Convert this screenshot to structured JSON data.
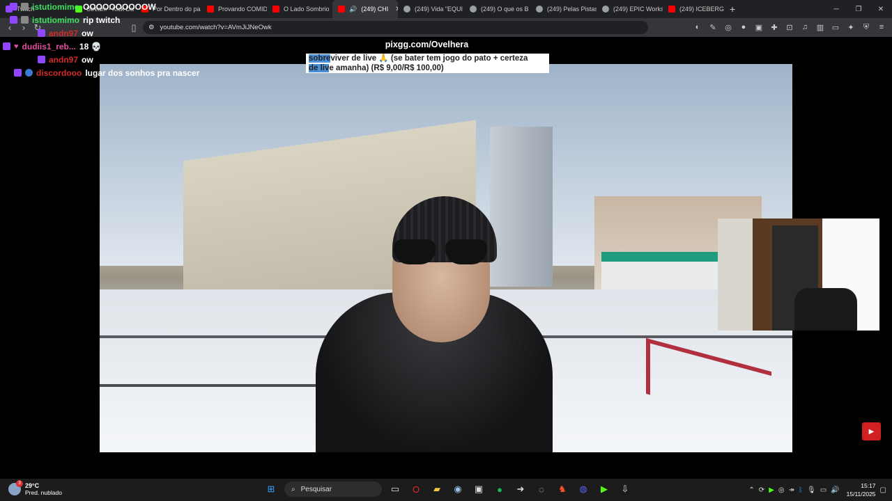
{
  "browser": {
    "tabs": [
      {
        "label": "Twitch",
        "color": "#9146ff"
      },
      {
        "label": "Stream - Kick Da",
        "color": "#53fc18"
      },
      {
        "label": "Por Dentro do pa",
        "color": "#ff0000"
      },
      {
        "label": "Provando COMID",
        "color": "#ff0000"
      },
      {
        "label": "O Lado Sombrio",
        "color": "#ff0000"
      },
      {
        "label": "(249) CHI",
        "color": "#ff0000"
      },
      {
        "label": "(249) Vida \"EQUI",
        "color": "#9aa0a6"
      },
      {
        "label": "(249) O que os B",
        "color": "#9aa0a6"
      },
      {
        "label": "(249) Pelas Pistas",
        "color": "#9aa0a6"
      },
      {
        "label": "(249) EPIC Works",
        "color": "#9aa0a6"
      },
      {
        "label": "(249) ICEBERG D",
        "color": "#ff0000"
      }
    ],
    "new_tab": "+",
    "url": "youtube.com/watch?v=AVmJiJNeOwk"
  },
  "chat": [
    {
      "user": "istutiomimo",
      "color": "#3fe060",
      "message": "OOOOOOOOOOW"
    },
    {
      "user": "istutiomimo",
      "color": "#3fe060",
      "message": "rip twitch"
    },
    {
      "user": "andn97",
      "color": "#d32b2b",
      "message": "ow"
    },
    {
      "user": "dudiis1_reb...",
      "color": "#e04fa0",
      "message": "18 💀"
    },
    {
      "user": "andn97",
      "color": "#d32b2b",
      "message": "ow"
    },
    {
      "user": "discordooo",
      "color": "#d32b2b",
      "message": "lugar dos sonhos pra nascer"
    }
  ],
  "overlay": {
    "pixgg": "pixgg.com/Ovelhera",
    "donation_hl1": "sobre",
    "donation_line1": "viver de live 🙏 (se bater tem jogo do pato + certeza",
    "donation_hl2": "de liv",
    "donation_line2": "e amanha) (R$ 9,00/R$ 100,00)"
  },
  "taskbar": {
    "weather_temp": "29°C",
    "weather_desc": "Pred. nublado",
    "weather_badge": "3",
    "search_placeholder": "Pesquisar",
    "time": "15:17",
    "date": "15/11/2025"
  }
}
